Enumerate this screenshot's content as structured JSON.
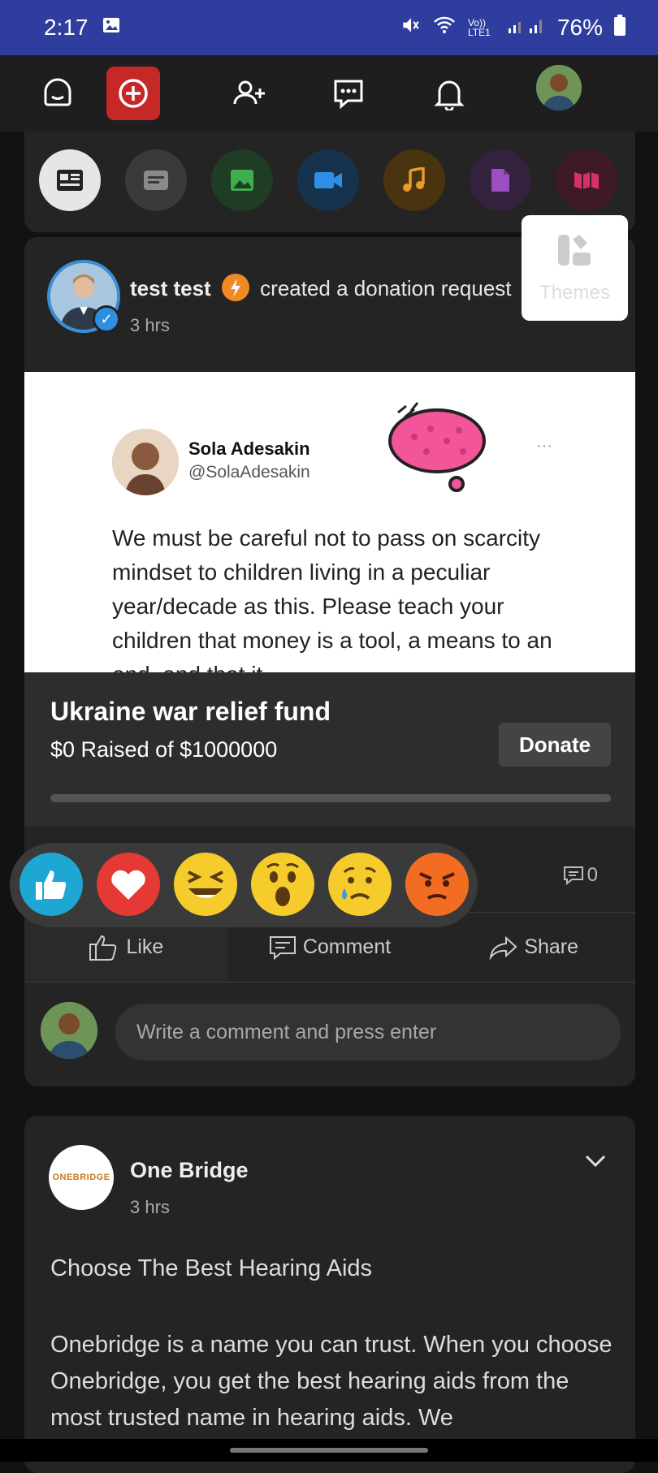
{
  "status_bar": {
    "time": "2:17",
    "network": "Vo)) LTE1",
    "battery": "76%"
  },
  "post_types": [
    {
      "name": "news",
      "color": "#e6e6e6"
    },
    {
      "name": "text",
      "color": "#3a3a3a"
    },
    {
      "name": "image",
      "color": "#1f3d24"
    },
    {
      "name": "video",
      "color": "#16324d"
    },
    {
      "name": "audio",
      "color": "#4a3410"
    },
    {
      "name": "file",
      "color": "#33213d"
    },
    {
      "name": "map",
      "color": "#3d1a26"
    }
  ],
  "themes_popup": {
    "label": "Themes"
  },
  "post1": {
    "author": "test test",
    "action": "created a donation request",
    "time": "3 hrs",
    "tweet": {
      "name": "Sola Adesakin",
      "handle": "@SolaAdesakin",
      "body": "We must be careful not to pass on scarcity mindset to children living in a peculiar year/decade as this. Please teach your children that money is a tool, a means to an end, and that it"
    },
    "donation": {
      "title": "Ukraine war relief fund",
      "raised": "$0 Raised of $1000000",
      "donate_label": "Donate",
      "progress_fraction": 0
    },
    "comment_count": "0",
    "actions": {
      "like": "Like",
      "comment": "Comment",
      "share": "Share"
    },
    "comment_placeholder": "Write a comment and press enter"
  },
  "reactions": [
    "like",
    "love",
    "haha",
    "wow",
    "sad",
    "angry"
  ],
  "post2": {
    "author": "One Bridge",
    "logo_text": "ONEBRIDGE",
    "time": "3 hrs",
    "title": "Choose The Best Hearing Aids",
    "body": "Onebridge is a name you can trust. When you choose Onebridge, you get the best hearing aids from the most trusted name in hearing aids. We"
  }
}
